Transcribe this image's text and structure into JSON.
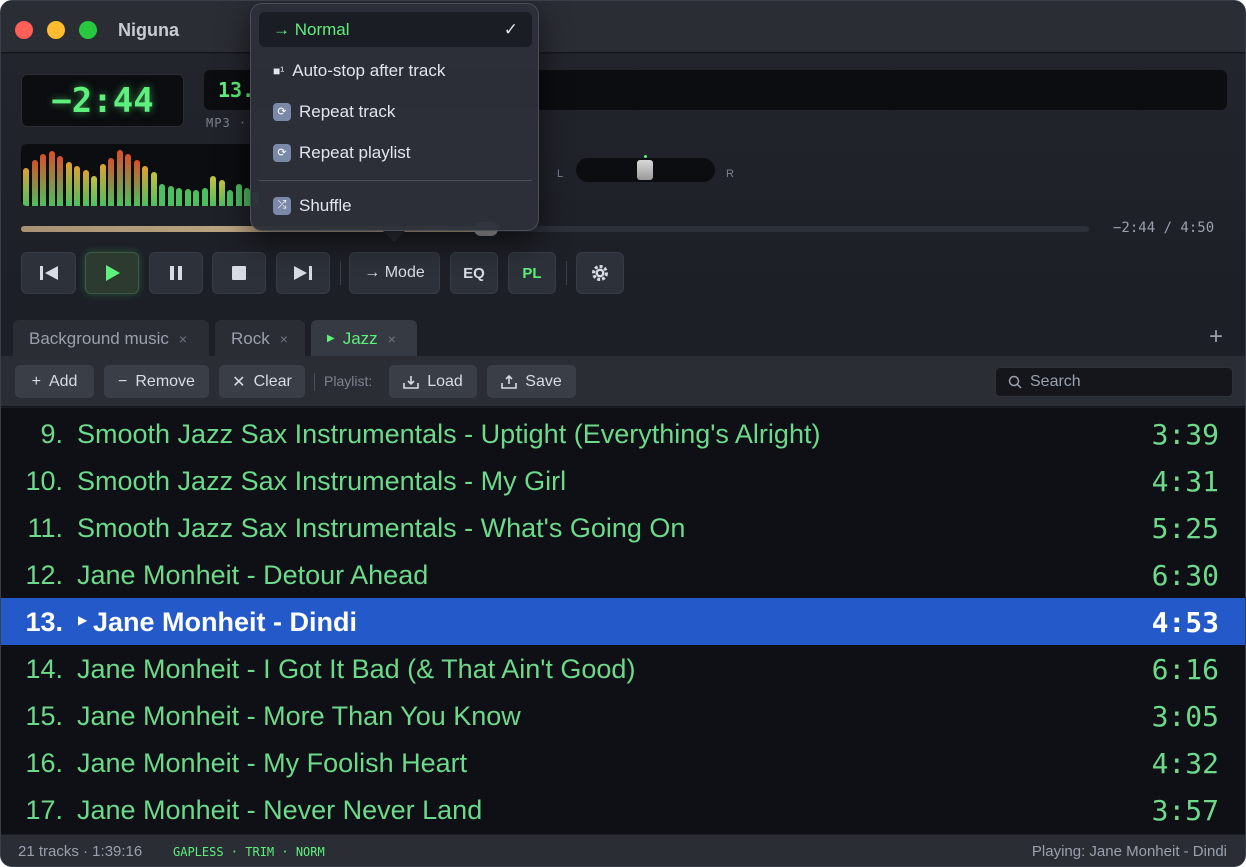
{
  "app": {
    "title": "Niguna"
  },
  "player": {
    "time_remaining": "−2:44",
    "track_number_display": "13.",
    "format": "MP3 ·",
    "balance_left": "L",
    "balance_right": "R",
    "seek_time": "−2:44 / 4:50",
    "progress_fraction": 0.43
  },
  "controls": {
    "mode_label": "→ Mode",
    "eq_label": "EQ",
    "pl_label": "PL"
  },
  "mode_menu": {
    "items": [
      {
        "label": "→ Normal",
        "selected": true,
        "check": "✓"
      },
      {
        "label": "Auto-stop after track",
        "icon": "auto-stop-icon",
        "icon_glyph": "■¹"
      },
      {
        "label": "Repeat track",
        "icon": "repeat-track-icon",
        "icon_glyph": "⟳"
      },
      {
        "label": "Repeat playlist",
        "icon": "repeat-playlist-icon",
        "icon_glyph": "⟳"
      },
      {
        "label": "Shuffle",
        "icon": "shuffle-icon",
        "icon_glyph": "⤮"
      }
    ]
  },
  "tabs": [
    {
      "label": "Background music",
      "close": "×",
      "active": false
    },
    {
      "label": "Rock",
      "close": "×",
      "active": false
    },
    {
      "label": "Jazz",
      "close": "×",
      "active": true,
      "indicator": "▶"
    }
  ],
  "tab_add": "+",
  "toolbar": {
    "add_label": "Add",
    "remove_label": "Remove",
    "clear_label": "Clear",
    "playlist_label": "Playlist:",
    "load_label": "Load",
    "save_label": "Save",
    "search_placeholder": "Search"
  },
  "playlist": [
    {
      "num": "9.",
      "title": "Smooth Jazz Sax Instrumentals - Uptight (Everything's Alright)",
      "duration": "3:39"
    },
    {
      "num": "10.",
      "title": "Smooth Jazz Sax Instrumentals - My Girl",
      "duration": "4:31"
    },
    {
      "num": "11.",
      "title": "Smooth Jazz Sax Instrumentals - What's Going On",
      "duration": "5:25"
    },
    {
      "num": "12.",
      "title": "Jane Monheit - Detour Ahead",
      "duration": "6:30"
    },
    {
      "num": "13.",
      "title": "Jane Monheit - Dindi",
      "duration": "4:53",
      "playing": true,
      "indicator": "▶"
    },
    {
      "num": "14.",
      "title": "Jane Monheit - I Got It Bad (& That Ain't Good)",
      "duration": "6:16"
    },
    {
      "num": "15.",
      "title": "Jane Monheit - More Than You Know",
      "duration": "3:05"
    },
    {
      "num": "16.",
      "title": "Jane Monheit - My Foolish Heart",
      "duration": "4:32"
    },
    {
      "num": "17.",
      "title": "Jane Monheit - Never Never Land",
      "duration": "3:57"
    }
  ],
  "status": {
    "summary": "21 tracks · 1:39:16",
    "flags": "GAPLESS · TRIM · NORM",
    "now_playing": "Playing: Jane Monheit - Dindi"
  },
  "colors": {
    "accent_green": "#5ef07c",
    "playing_row": "#2459c9",
    "track_text": "#6dd98a"
  }
}
